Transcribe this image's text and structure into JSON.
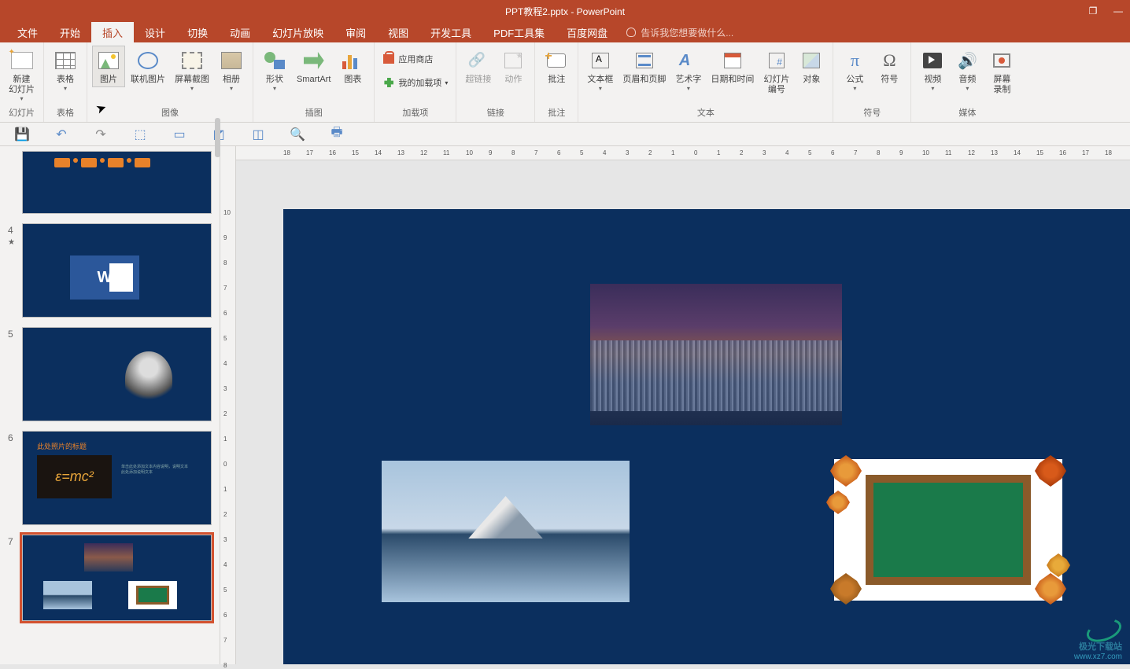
{
  "app": {
    "title": "PPT教程2.pptx - PowerPoint"
  },
  "win": {
    "restore": "❐",
    "minimize": "—"
  },
  "tabs": {
    "file": "文件",
    "home": "开始",
    "insert": "插入",
    "design": "设计",
    "transitions": "切换",
    "animations": "动画",
    "slideshow": "幻灯片放映",
    "review": "审阅",
    "view": "视图",
    "developer": "开发工具",
    "pdf": "PDF工具集",
    "baidu": "百度网盘"
  },
  "tellme": {
    "placeholder": "告诉我您想要做什么..."
  },
  "ribbon": {
    "slides": {
      "new_slide": "新建\n幻灯片",
      "label": "幻灯片"
    },
    "tables": {
      "table": "表格",
      "label": "表格"
    },
    "images": {
      "picture": "图片",
      "online": "联机图片",
      "screenshot": "屏幕截图",
      "album": "相册",
      "label": "图像"
    },
    "illustrations": {
      "shapes": "形状",
      "smartart": "SmartArt",
      "chart": "图表",
      "label": "插图"
    },
    "addins": {
      "store": "应用商店",
      "myaddins": "我的加载项",
      "label": "加载项"
    },
    "links": {
      "hyperlink": "超链接",
      "action": "动作",
      "label": "链接"
    },
    "comments": {
      "comment": "批注",
      "label": "批注"
    },
    "text": {
      "textbox": "文本框",
      "headerfooter": "页眉和页脚",
      "wordart": "艺术字",
      "datetime": "日期和时间",
      "slidenum": "幻灯片\n编号",
      "object": "对象",
      "label": "文本"
    },
    "symbols": {
      "equation": "公式",
      "symbol": "符号",
      "label": "符号"
    },
    "media": {
      "video": "视频",
      "audio": "音频",
      "screenrec": "屏幕\n录制",
      "label": "媒体"
    }
  },
  "thumbs": {
    "n4": "4",
    "n5": "5",
    "n6": "6",
    "n7": "7",
    "t6_title": "此处照片的标题",
    "t6_formula": "ε=mc²",
    "t6_text": "单击此处添加文本内容说明，说明文本\n此处添加说明文本"
  },
  "hruler_marks": [
    "18",
    "17",
    "16",
    "15",
    "14",
    "13",
    "12",
    "11",
    "10",
    "9",
    "8",
    "7",
    "6",
    "5",
    "4",
    "3",
    "2",
    "1",
    "0",
    "1",
    "2",
    "3",
    "4",
    "5",
    "6",
    "7",
    "8",
    "9",
    "10",
    "11",
    "12",
    "13",
    "14",
    "15",
    "16",
    "17",
    "18"
  ],
  "vruler_marks": [
    "10",
    "9",
    "8",
    "7",
    "6",
    "5",
    "4",
    "3",
    "2",
    "1",
    "0",
    "1",
    "2",
    "3",
    "4",
    "5",
    "6",
    "7",
    "8"
  ],
  "watermark": {
    "name": "极光下载站",
    "url": "www.xz7.com"
  }
}
